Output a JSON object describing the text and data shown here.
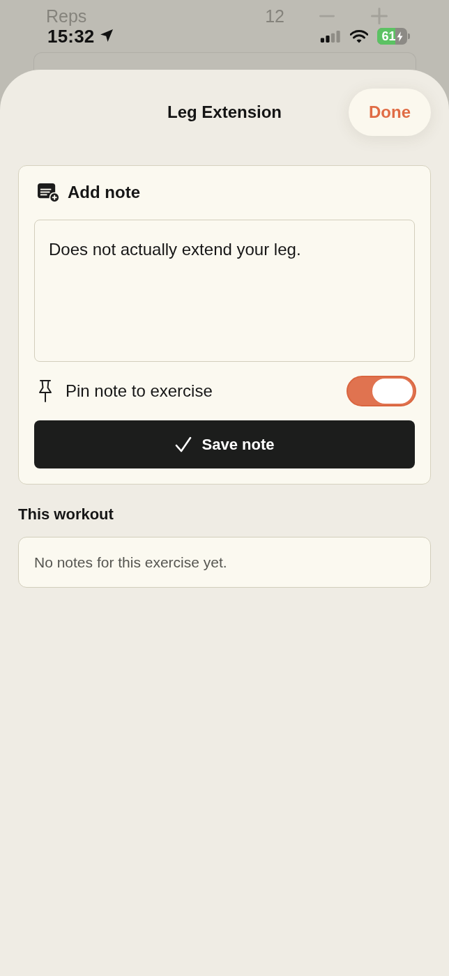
{
  "background_page": {
    "row_label": "Reps",
    "value": "12"
  },
  "status_bar": {
    "time": "15:32",
    "battery": "61",
    "charging": true
  },
  "sheet": {
    "title": "Leg Extension",
    "done_button": "Done"
  },
  "add_note": {
    "title": "Add note",
    "note_field": {
      "value": "Does not actually extend your leg."
    },
    "pin_toggle": {
      "label": "Pin note to exercise",
      "on": true
    },
    "save_button": "Save note"
  },
  "this_workout": {
    "title": "This workout",
    "empty_message": "No notes for this exercise yet."
  }
}
